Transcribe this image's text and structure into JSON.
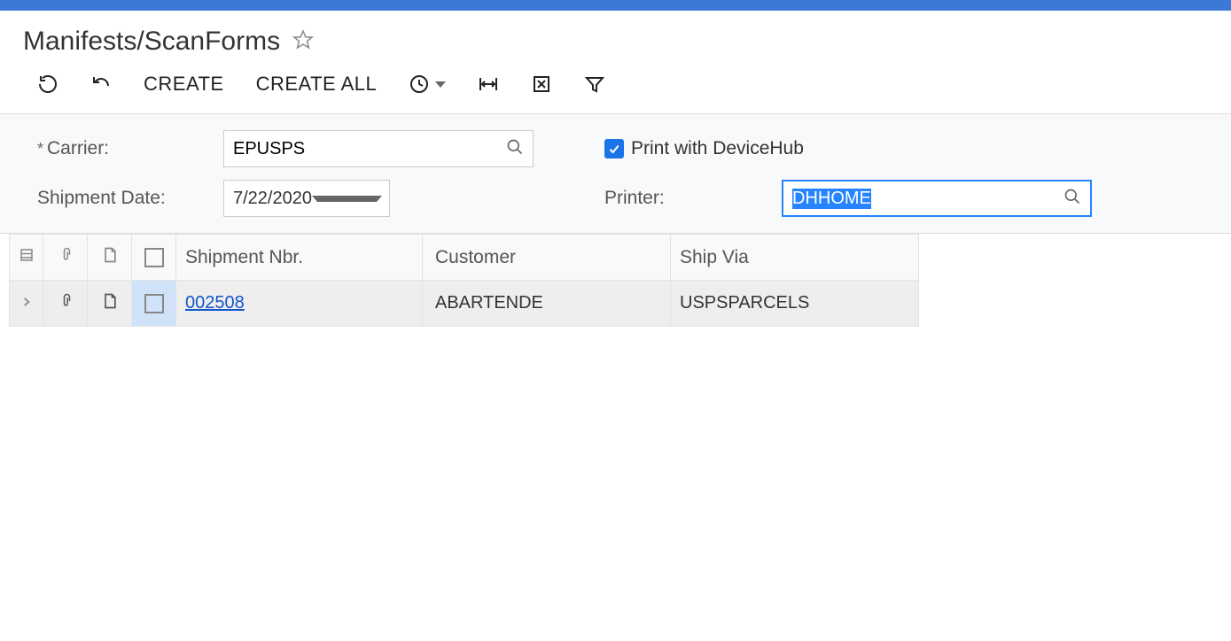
{
  "title": "Manifests/ScanForms",
  "toolbar": {
    "create_label": "CREATE",
    "create_all_label": "CREATE ALL"
  },
  "form": {
    "carrier_label": "Carrier:",
    "carrier_value": "EPUSPS",
    "shipment_date_label": "Shipment Date:",
    "shipment_date_value": "7/22/2020",
    "print_dh_label": "Print with DeviceHub",
    "print_dh_checked": true,
    "printer_label": "Printer:",
    "printer_value": "DHHOME"
  },
  "grid": {
    "headers": {
      "shipment_nbr": "Shipment Nbr.",
      "customer": "Customer",
      "ship_via": "Ship Via"
    },
    "rows": [
      {
        "shipment_nbr": "002508",
        "customer": "ABARTENDE",
        "ship_via": "USPSPARCELS"
      }
    ]
  }
}
